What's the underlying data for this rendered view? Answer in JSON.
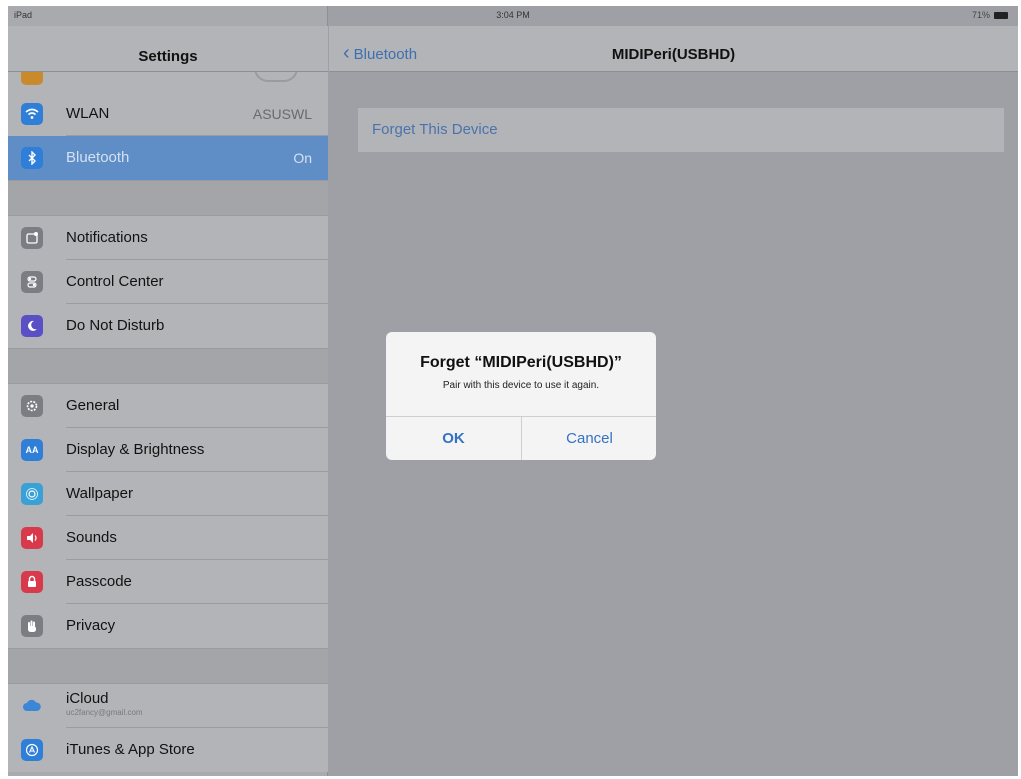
{
  "status_bar": {
    "carrier": "iPad",
    "time": "3:04 PM",
    "battery": "71%"
  },
  "sidebar": {
    "title": "Settings",
    "rows": [
      {
        "label": "WLAN",
        "value": "ASUSWL",
        "icon": "wifi-icon",
        "color": "#2f7ed8"
      },
      {
        "label": "Bluetooth",
        "value": "On",
        "icon": "bluetooth-icon",
        "color": "#2f7ed8",
        "selected": true
      },
      {
        "label": "Notifications",
        "icon": "notifications-icon",
        "color": "#7b7d82"
      },
      {
        "label": "Control Center",
        "icon": "control-center-icon",
        "color": "#7b7d82"
      },
      {
        "label": "Do Not Disturb",
        "icon": "moon-icon",
        "color": "#5a4fc4"
      },
      {
        "label": "General",
        "icon": "gear-icon",
        "color": "#7b7d82"
      },
      {
        "label": "Display & Brightness",
        "icon": "display-icon",
        "color": "#2f7ed8"
      },
      {
        "label": "Wallpaper",
        "icon": "wallpaper-icon",
        "color": "#3aa0d6"
      },
      {
        "label": "Sounds",
        "icon": "speaker-icon",
        "color": "#d83a4b"
      },
      {
        "label": "Passcode",
        "icon": "lock-icon",
        "color": "#d83a4b"
      },
      {
        "label": "Privacy",
        "icon": "hand-icon",
        "color": "#7b7d82"
      },
      {
        "label": "iCloud",
        "sublabel": "uc2fancy@gmail.com",
        "icon": "cloud-icon",
        "color": "#2f7ed8"
      },
      {
        "label": "iTunes & App Store",
        "icon": "app-store-icon",
        "color": "#2f7ed8"
      }
    ]
  },
  "detail": {
    "back_label": "Bluetooth",
    "title": "MIDIPeri(USBHD)",
    "forget_label": "Forget This Device"
  },
  "alert": {
    "title": "Forget “MIDIPeri(USBHD)”",
    "message": "Pair with this device to use it again.",
    "ok_label": "OK",
    "cancel_label": "Cancel"
  }
}
